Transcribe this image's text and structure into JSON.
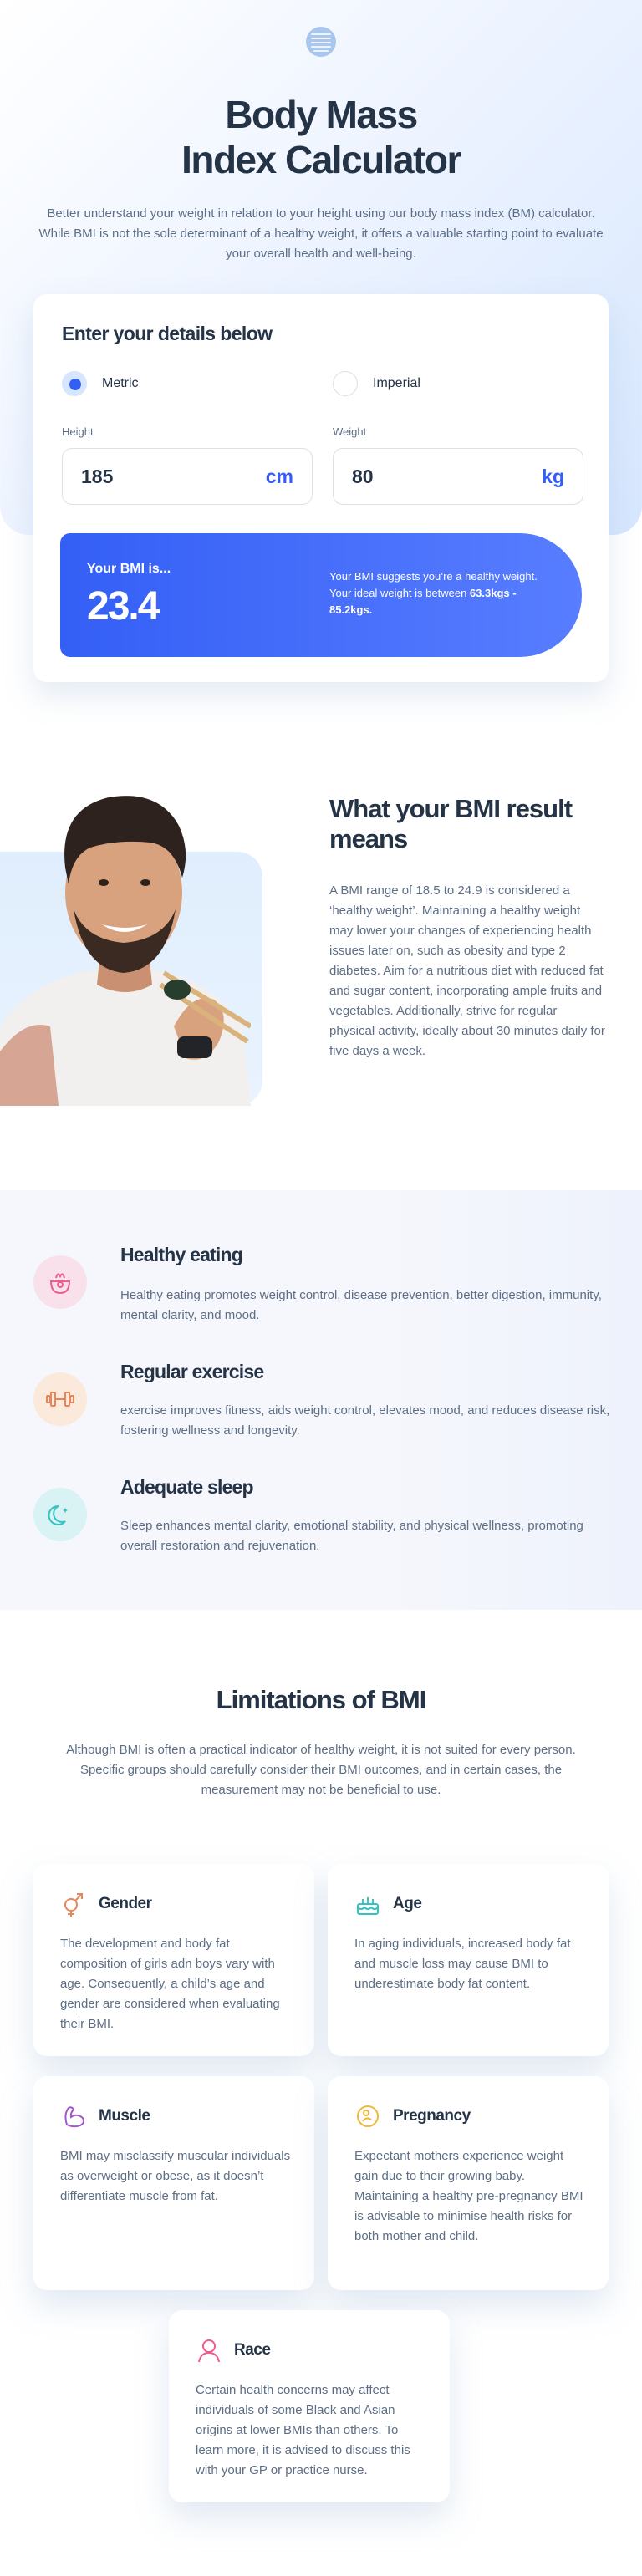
{
  "header": {
    "title_line1": "Body Mass",
    "title_line2": "Index Calculator",
    "intro": "Better understand your weight in relation to your height using our body mass index (BM) calculator. While BMI is not the sole determinant of a healthy weight, it offers a valuable starting point to evaluate your overall health and well-being."
  },
  "calculator": {
    "heading": "Enter your details below",
    "units": [
      {
        "label": "Metric",
        "selected": true
      },
      {
        "label": "Imperial",
        "selected": false
      }
    ],
    "height": {
      "label": "Height",
      "value": "185",
      "unit": "cm"
    },
    "weight": {
      "label": "Weight",
      "value": "80",
      "unit": "kg"
    },
    "result": {
      "label": "Your BMI is...",
      "value": "23.4",
      "text": "Your BMI suggests you’re a healthy weight. Your ideal weight is between",
      "range": "63.3kgs - 85.2kgs."
    }
  },
  "meaning": {
    "title": "What your BMI result means",
    "text": "A BMI range of 18.5 to 24.9 is considered a ‘healthy weight’. Maintaining a healthy weight may lower your changes of experiencing health issues later on, such as obesity and type 2 diabetes. Aim for a nutritious diet with reduced fat and sugar content, incorporating ample fruits and vegetables. Additionally, strive for regular physical activity, ideally about 30 minutes daily for five days a week."
  },
  "tips": [
    {
      "title": "Healthy eating",
      "icon": "eating-icon",
      "color": "#f9e1ec",
      "text": "Healthy eating promotes weight control, disease prevention, better digestion, immunity, mental clarity, and mood."
    },
    {
      "title": "Regular exercise",
      "icon": "dumbbell-icon",
      "color": "#fbe9dc",
      "text": "exercise improves fitness, aids weight control, elevates mood, and reduces disease risk, fostering wellness and longevity."
    },
    {
      "title": "Adequate sleep",
      "icon": "moon-icon",
      "color": "#d9f2f3",
      "text": "Sleep enhances mental clarity, emotional stability, and physical wellness, promoting overall restoration and rejuvenation."
    }
  ],
  "limitations": {
    "title": "Limitations of BMI",
    "text": "Although BMI is often a practical indicator of healthy weight, it is not suited for every person. Specific groups should carefully consider their BMI outcomes, and in certain cases, the measurement may not be beneficial to use.",
    "cards": [
      {
        "title": "Gender",
        "icon": "gender-icon",
        "text": "The development and body fat composition of girls adn boys vary with age. Consequently, a child’s age and gender are considered when evaluating their BMI."
      },
      {
        "title": "Age",
        "icon": "birthday-cake-icon",
        "text": "In aging individuals, increased body fat and muscle loss may cause BMI to underestimate body fat content."
      },
      {
        "title": "Muscle",
        "icon": "muscle-icon",
        "text": "BMI may misclassify muscular individuals as overweight or obese, as it doesn’t differentiate muscle from fat."
      },
      {
        "title": "Pregnancy",
        "icon": "pregnancy-icon",
        "text": "Expectant mothers experience weight gain due to their growing baby. Maintaining a healthy pre-pregnancy BMI is advisable to minimise health risks for both mother and child."
      },
      {
        "title": "Race",
        "icon": "race-icon",
        "text": "Certain health concerns may affect individuals of some Black and Asian origins at lower BMIs than others. To learn more, it is advised to discuss this with your GP or practice nurse."
      }
    ]
  },
  "colors": {
    "primary": "#345ff6",
    "heading": "#253347",
    "body": "#5e6e85",
    "hero_gradient_end": "#d6e6fe"
  }
}
